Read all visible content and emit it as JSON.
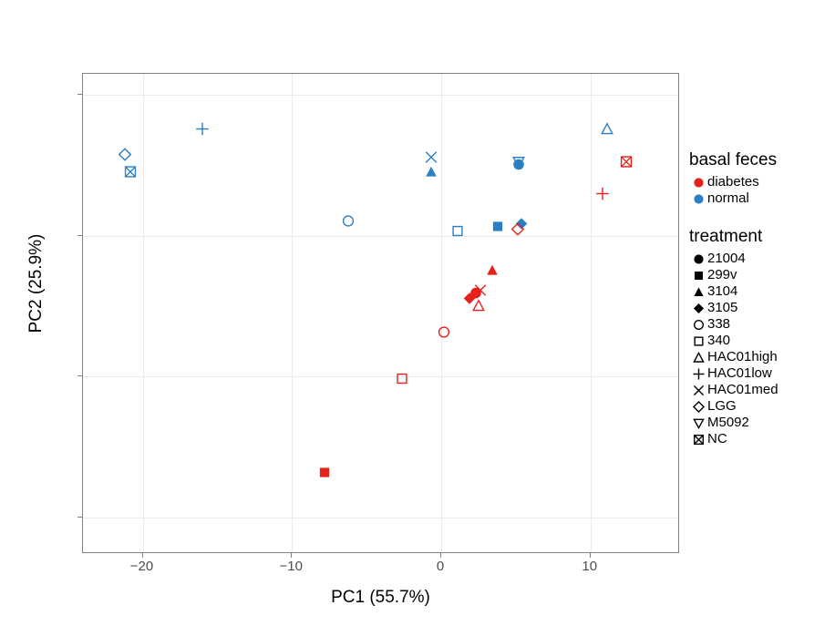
{
  "chart_data": {
    "type": "scatter",
    "title": "",
    "xlabel": "PC1 (55.7%)",
    "ylabel": "PC2 (25.9%)",
    "xlim": [
      -24,
      16
    ],
    "ylim": [
      -22.6,
      11.5
    ],
    "xticks": [
      -20,
      -10,
      0,
      10
    ],
    "yticks": [
      10,
      0,
      -10,
      -20
    ],
    "grid": true,
    "legend_position": "right",
    "colors": {
      "diabetes": "#e8201c",
      "normal": "#2b7fc4",
      "panel_border": "#7f7f7f",
      "gridline": "#ebebeb"
    },
    "color_legend": {
      "title": "basal feces",
      "entries": [
        {
          "label": "diabetes",
          "color": "#e8201c",
          "shape": "circle-filled"
        },
        {
          "label": "normal",
          "color": "#2b7fc4",
          "shape": "circle-filled"
        }
      ]
    },
    "shape_legend": {
      "title": "treatment",
      "entries": [
        {
          "label": "21004",
          "shape": "circle-filled"
        },
        {
          "label": "299v",
          "shape": "square-filled"
        },
        {
          "label": "3104",
          "shape": "triangle-filled"
        },
        {
          "label": "3105",
          "shape": "diamond-filled"
        },
        {
          "label": "338",
          "shape": "circle-open"
        },
        {
          "label": "340",
          "shape": "square-open"
        },
        {
          "label": "HAC01high",
          "shape": "triangle-open"
        },
        {
          "label": "HAC01low",
          "shape": "plus"
        },
        {
          "label": "HAC01med",
          "shape": "cross"
        },
        {
          "label": "LGG",
          "shape": "diamond-open"
        },
        {
          "label": "M5092",
          "shape": "triangle-down-open"
        },
        {
          "label": "NC",
          "shape": "square-cross"
        }
      ]
    },
    "points": [
      {
        "x": -16.0,
        "y": 7.4,
        "group": "normal",
        "treatment": "HAC01low",
        "shape": "plus"
      },
      {
        "x": -21.2,
        "y": 5.6,
        "group": "normal",
        "treatment": "LGG",
        "shape": "diamond-open"
      },
      {
        "x": -20.8,
        "y": 4.4,
        "group": "normal",
        "treatment": "NC",
        "shape": "square-cross"
      },
      {
        "x": -6.2,
        "y": 0.9,
        "group": "normal",
        "treatment": "338",
        "shape": "circle-open"
      },
      {
        "x": -0.7,
        "y": 5.4,
        "group": "normal",
        "treatment": "HAC01med",
        "shape": "cross"
      },
      {
        "x": -0.7,
        "y": 4.4,
        "group": "normal",
        "treatment": "3104",
        "shape": "triangle-filled"
      },
      {
        "x": 5.2,
        "y": 5.1,
        "group": "normal",
        "treatment": "M5092",
        "shape": "triangle-down-open"
      },
      {
        "x": 5.2,
        "y": 4.9,
        "group": "normal",
        "treatment": "21004",
        "shape": "circle-filled"
      },
      {
        "x": 11.1,
        "y": 7.4,
        "group": "normal",
        "treatment": "HAC01high",
        "shape": "triangle-open"
      },
      {
        "x": 1.1,
        "y": 0.2,
        "group": "normal",
        "treatment": "340",
        "shape": "square-open"
      },
      {
        "x": 3.8,
        "y": 0.5,
        "group": "normal",
        "treatment": "299v",
        "shape": "square-filled"
      },
      {
        "x": 5.4,
        "y": 0.7,
        "group": "normal",
        "treatment": "3105",
        "shape": "diamond-filled"
      },
      {
        "x": 12.4,
        "y": 5.1,
        "group": "diabetes",
        "treatment": "NC",
        "shape": "square-cross"
      },
      {
        "x": 10.8,
        "y": 2.8,
        "group": "diabetes",
        "treatment": "HAC01low",
        "shape": "plus"
      },
      {
        "x": 5.1,
        "y": 0.3,
        "group": "diabetes",
        "treatment": "LGG",
        "shape": "diamond-open"
      },
      {
        "x": 3.4,
        "y": -2.6,
        "group": "diabetes",
        "treatment": "3104",
        "shape": "triangle-filled"
      },
      {
        "x": 2.6,
        "y": -4.0,
        "group": "diabetes",
        "treatment": "HAC01med",
        "shape": "cross"
      },
      {
        "x": 2.3,
        "y": -4.2,
        "group": "diabetes",
        "treatment": "21004",
        "shape": "circle-filled"
      },
      {
        "x": 1.9,
        "y": -4.6,
        "group": "diabetes",
        "treatment": "3105",
        "shape": "diamond-filled"
      },
      {
        "x": 2.5,
        "y": -5.1,
        "group": "diabetes",
        "treatment": "HAC01high",
        "shape": "triangle-open"
      },
      {
        "x": 0.2,
        "y": -7.0,
        "group": "diabetes",
        "treatment": "338",
        "shape": "circle-open"
      },
      {
        "x": -2.6,
        "y": -10.3,
        "group": "diabetes",
        "treatment": "340",
        "shape": "square-open"
      },
      {
        "x": -7.8,
        "y": -17.0,
        "group": "diabetes",
        "treatment": "299v",
        "shape": "square-filled"
      }
    ]
  }
}
